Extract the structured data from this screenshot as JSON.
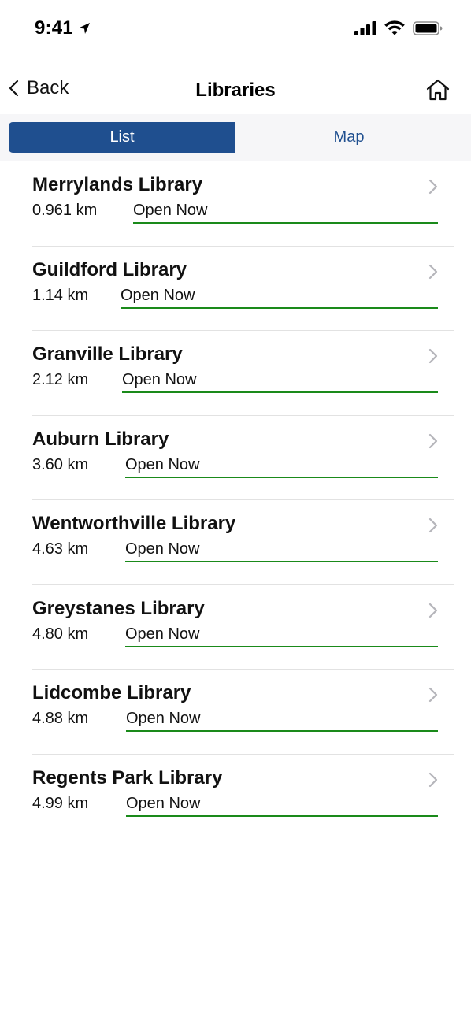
{
  "status_bar": {
    "time": "9:41"
  },
  "nav": {
    "back_label": "Back",
    "title": "Libraries"
  },
  "segments": {
    "list_label": "List",
    "map_label": "Map"
  },
  "colors": {
    "accent": "#1f4f8f",
    "open_underline": "#1a8a1a"
  },
  "libraries": [
    {
      "name": "Merrylands Library",
      "distance": "0.961 km",
      "status": "Open Now"
    },
    {
      "name": "Guildford Library",
      "distance": "1.14 km",
      "status": "Open Now"
    },
    {
      "name": "Granville Library",
      "distance": "2.12 km",
      "status": "Open Now"
    },
    {
      "name": "Auburn Library",
      "distance": "3.60 km",
      "status": "Open Now"
    },
    {
      "name": "Wentworthville Library",
      "distance": "4.63 km",
      "status": "Open Now"
    },
    {
      "name": "Greystanes Library",
      "distance": "4.80 km",
      "status": "Open Now"
    },
    {
      "name": "Lidcombe Library",
      "distance": "4.88 km",
      "status": "Open Now"
    },
    {
      "name": "Regents Park Library",
      "distance": "4.99 km",
      "status": "Open Now"
    }
  ]
}
